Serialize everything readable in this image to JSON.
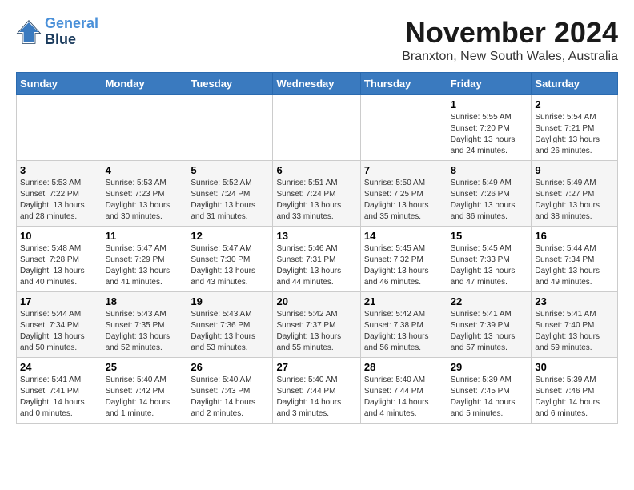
{
  "logo": {
    "line1": "General",
    "line2": "Blue"
  },
  "title": "November 2024",
  "location": "Branxton, New South Wales, Australia",
  "weekdays": [
    "Sunday",
    "Monday",
    "Tuesday",
    "Wednesday",
    "Thursday",
    "Friday",
    "Saturday"
  ],
  "weeks": [
    [
      {
        "day": "",
        "info": ""
      },
      {
        "day": "",
        "info": ""
      },
      {
        "day": "",
        "info": ""
      },
      {
        "day": "",
        "info": ""
      },
      {
        "day": "",
        "info": ""
      },
      {
        "day": "1",
        "info": "Sunrise: 5:55 AM\nSunset: 7:20 PM\nDaylight: 13 hours\nand 24 minutes."
      },
      {
        "day": "2",
        "info": "Sunrise: 5:54 AM\nSunset: 7:21 PM\nDaylight: 13 hours\nand 26 minutes."
      }
    ],
    [
      {
        "day": "3",
        "info": "Sunrise: 5:53 AM\nSunset: 7:22 PM\nDaylight: 13 hours\nand 28 minutes."
      },
      {
        "day": "4",
        "info": "Sunrise: 5:53 AM\nSunset: 7:23 PM\nDaylight: 13 hours\nand 30 minutes."
      },
      {
        "day": "5",
        "info": "Sunrise: 5:52 AM\nSunset: 7:24 PM\nDaylight: 13 hours\nand 31 minutes."
      },
      {
        "day": "6",
        "info": "Sunrise: 5:51 AM\nSunset: 7:24 PM\nDaylight: 13 hours\nand 33 minutes."
      },
      {
        "day": "7",
        "info": "Sunrise: 5:50 AM\nSunset: 7:25 PM\nDaylight: 13 hours\nand 35 minutes."
      },
      {
        "day": "8",
        "info": "Sunrise: 5:49 AM\nSunset: 7:26 PM\nDaylight: 13 hours\nand 36 minutes."
      },
      {
        "day": "9",
        "info": "Sunrise: 5:49 AM\nSunset: 7:27 PM\nDaylight: 13 hours\nand 38 minutes."
      }
    ],
    [
      {
        "day": "10",
        "info": "Sunrise: 5:48 AM\nSunset: 7:28 PM\nDaylight: 13 hours\nand 40 minutes."
      },
      {
        "day": "11",
        "info": "Sunrise: 5:47 AM\nSunset: 7:29 PM\nDaylight: 13 hours\nand 41 minutes."
      },
      {
        "day": "12",
        "info": "Sunrise: 5:47 AM\nSunset: 7:30 PM\nDaylight: 13 hours\nand 43 minutes."
      },
      {
        "day": "13",
        "info": "Sunrise: 5:46 AM\nSunset: 7:31 PM\nDaylight: 13 hours\nand 44 minutes."
      },
      {
        "day": "14",
        "info": "Sunrise: 5:45 AM\nSunset: 7:32 PM\nDaylight: 13 hours\nand 46 minutes."
      },
      {
        "day": "15",
        "info": "Sunrise: 5:45 AM\nSunset: 7:33 PM\nDaylight: 13 hours\nand 47 minutes."
      },
      {
        "day": "16",
        "info": "Sunrise: 5:44 AM\nSunset: 7:34 PM\nDaylight: 13 hours\nand 49 minutes."
      }
    ],
    [
      {
        "day": "17",
        "info": "Sunrise: 5:44 AM\nSunset: 7:34 PM\nDaylight: 13 hours\nand 50 minutes."
      },
      {
        "day": "18",
        "info": "Sunrise: 5:43 AM\nSunset: 7:35 PM\nDaylight: 13 hours\nand 52 minutes."
      },
      {
        "day": "19",
        "info": "Sunrise: 5:43 AM\nSunset: 7:36 PM\nDaylight: 13 hours\nand 53 minutes."
      },
      {
        "day": "20",
        "info": "Sunrise: 5:42 AM\nSunset: 7:37 PM\nDaylight: 13 hours\nand 55 minutes."
      },
      {
        "day": "21",
        "info": "Sunrise: 5:42 AM\nSunset: 7:38 PM\nDaylight: 13 hours\nand 56 minutes."
      },
      {
        "day": "22",
        "info": "Sunrise: 5:41 AM\nSunset: 7:39 PM\nDaylight: 13 hours\nand 57 minutes."
      },
      {
        "day": "23",
        "info": "Sunrise: 5:41 AM\nSunset: 7:40 PM\nDaylight: 13 hours\nand 59 minutes."
      }
    ],
    [
      {
        "day": "24",
        "info": "Sunrise: 5:41 AM\nSunset: 7:41 PM\nDaylight: 14 hours\nand 0 minutes."
      },
      {
        "day": "25",
        "info": "Sunrise: 5:40 AM\nSunset: 7:42 PM\nDaylight: 14 hours\nand 1 minute."
      },
      {
        "day": "26",
        "info": "Sunrise: 5:40 AM\nSunset: 7:43 PM\nDaylight: 14 hours\nand 2 minutes."
      },
      {
        "day": "27",
        "info": "Sunrise: 5:40 AM\nSunset: 7:44 PM\nDaylight: 14 hours\nand 3 minutes."
      },
      {
        "day": "28",
        "info": "Sunrise: 5:40 AM\nSunset: 7:44 PM\nDaylight: 14 hours\nand 4 minutes."
      },
      {
        "day": "29",
        "info": "Sunrise: 5:39 AM\nSunset: 7:45 PM\nDaylight: 14 hours\nand 5 minutes."
      },
      {
        "day": "30",
        "info": "Sunrise: 5:39 AM\nSunset: 7:46 PM\nDaylight: 14 hours\nand 6 minutes."
      }
    ]
  ]
}
